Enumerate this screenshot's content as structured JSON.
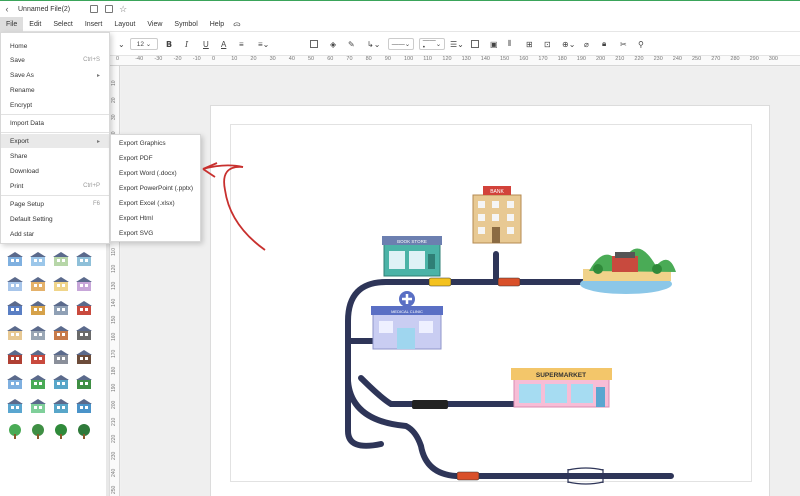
{
  "titlebar": {
    "file_name": "Unnamed File(2)",
    "back_icon": "chevron-left-icon"
  },
  "menubar": {
    "items": [
      "File",
      "Edit",
      "Select",
      "Insert",
      "Layout",
      "View",
      "Symbol",
      "Help"
    ]
  },
  "toolbar": {
    "font_size": "12",
    "line_style_label": "——",
    "arrow_style_label": "——•"
  },
  "ruler": {
    "h_ticks": [
      "0",
      "-40",
      "-30",
      "-20",
      "-10",
      "0",
      "10",
      "20",
      "30",
      "40",
      "50",
      "60",
      "70",
      "80",
      "90",
      "100",
      "110",
      "120",
      "130",
      "140",
      "150",
      "160",
      "170",
      "180",
      "190",
      "200",
      "210",
      "220",
      "230",
      "240",
      "250",
      "270",
      "280",
      "290",
      "300"
    ],
    "v_ticks": [
      "10",
      "20",
      "30",
      "40",
      "50",
      "60",
      "70",
      "80",
      "90",
      "100",
      "110",
      "120",
      "130",
      "140",
      "150",
      "160",
      "170",
      "180",
      "190",
      "200",
      "210",
      "220",
      "230",
      "240",
      "250"
    ]
  },
  "file_menu": {
    "items": [
      {
        "label": "Home",
        "shortcut": ""
      },
      {
        "label": "Save",
        "shortcut": "Ctrl+S"
      },
      {
        "label": "Save As",
        "shortcut": ""
      },
      {
        "label": "Rename",
        "shortcut": ""
      },
      {
        "label": "Encrypt",
        "shortcut": ""
      },
      {
        "label": "Import Data",
        "shortcut": ""
      },
      {
        "label": "Export",
        "shortcut": ""
      },
      {
        "label": "Share",
        "shortcut": ""
      },
      {
        "label": "Download",
        "shortcut": ""
      },
      {
        "label": "Print",
        "shortcut": "Ctrl+P"
      },
      {
        "label": "Page Setup",
        "shortcut": "F6"
      },
      {
        "label": "Default Setting",
        "shortcut": ""
      },
      {
        "label": "Add star",
        "shortcut": ""
      }
    ]
  },
  "export_submenu": {
    "items": [
      "Export Graphics",
      "Export PDF",
      "Export Word (.docx)",
      "Export PowerPoint (.pptx)",
      "Export Excel (.xlsx)",
      "Export Html",
      "Export SVG"
    ]
  },
  "diagram": {
    "bank_sign": "BANK",
    "bookstore_sign": "BOOK STORE",
    "clinic_sign": "MEDICAL CLINIC",
    "supermarket_sign": "SUPERMARKET"
  },
  "colors": {
    "road": "#2e3558",
    "accent_green": "#3aa45a",
    "annotation_red": "#c8302e"
  }
}
